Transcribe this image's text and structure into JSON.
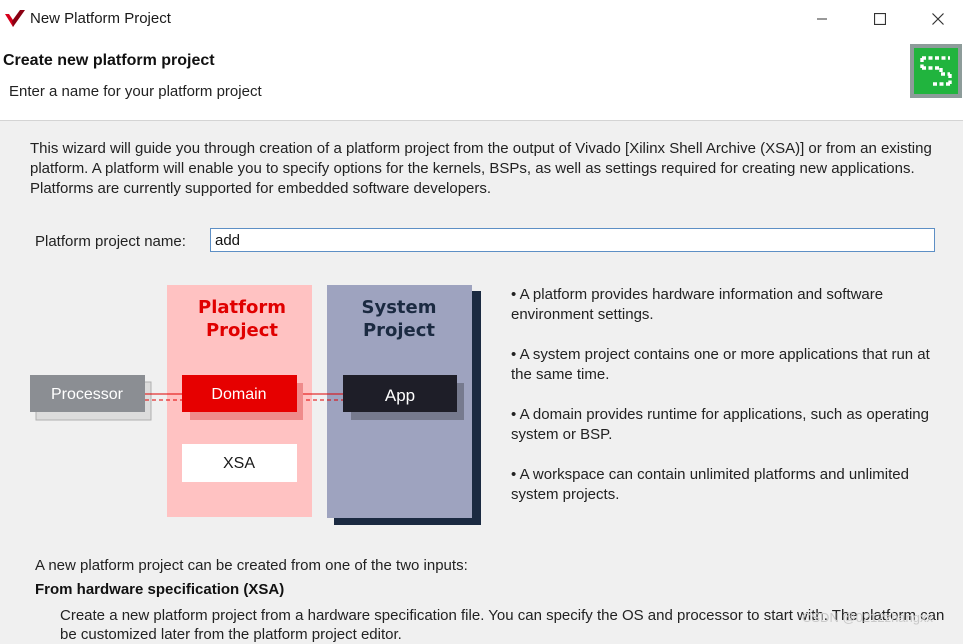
{
  "window": {
    "title": "New Platform Project"
  },
  "header": {
    "title": "Create new platform project",
    "subtitle": "Enter a name for your platform project"
  },
  "intro_text": "This wizard will guide you through creation of a platform project from the output of Vivado [Xilinx Shell Archive (XSA)] or from an existing platform. A platform will enable you to specify options for the kernels, BSPs, as well as settings required for creating new applications. Platforms are currently supported for embedded software developers.",
  "form": {
    "name_label": "Platform project name:",
    "name_value": "add"
  },
  "diagram": {
    "processor": "Processor",
    "platform_title_1": "Platform",
    "platform_title_2": "Project",
    "domain": "Domain",
    "xsa": "XSA",
    "system_title_1": "System",
    "system_title_2": "Project",
    "app": "App",
    "colors": {
      "platform_panel": "#ffc2c2",
      "platform_accent": "#e00000",
      "system_panel": "#9ea3bf",
      "system_shadow": "#1b2a41",
      "app_box": "#1e1e28",
      "processor_box": "#8b8e93"
    }
  },
  "bullets": [
    "• A platform provides hardware information and software environment settings.",
    "• A system project contains one or more applications that run at the same time.",
    "• A domain provides runtime for applications, such as operating system or BSP.",
    "• A workspace can contain unlimited platforms and unlimited system projects."
  ],
  "inputs_intro": "A new platform project can be created from one of the two inputs:",
  "option_heading": "From hardware specification (XSA)",
  "option_desc": "Create a new platform project from a hardware specification file. You can specify the OS and processor to start with. The platform can be customized later from the platform project editor.",
  "watermark": "CSDN @0212zhangxx",
  "icons": [
    "vitis-logo-icon",
    "minimize-icon",
    "maximize-icon",
    "close-icon",
    "wizard-logo-icon"
  ]
}
